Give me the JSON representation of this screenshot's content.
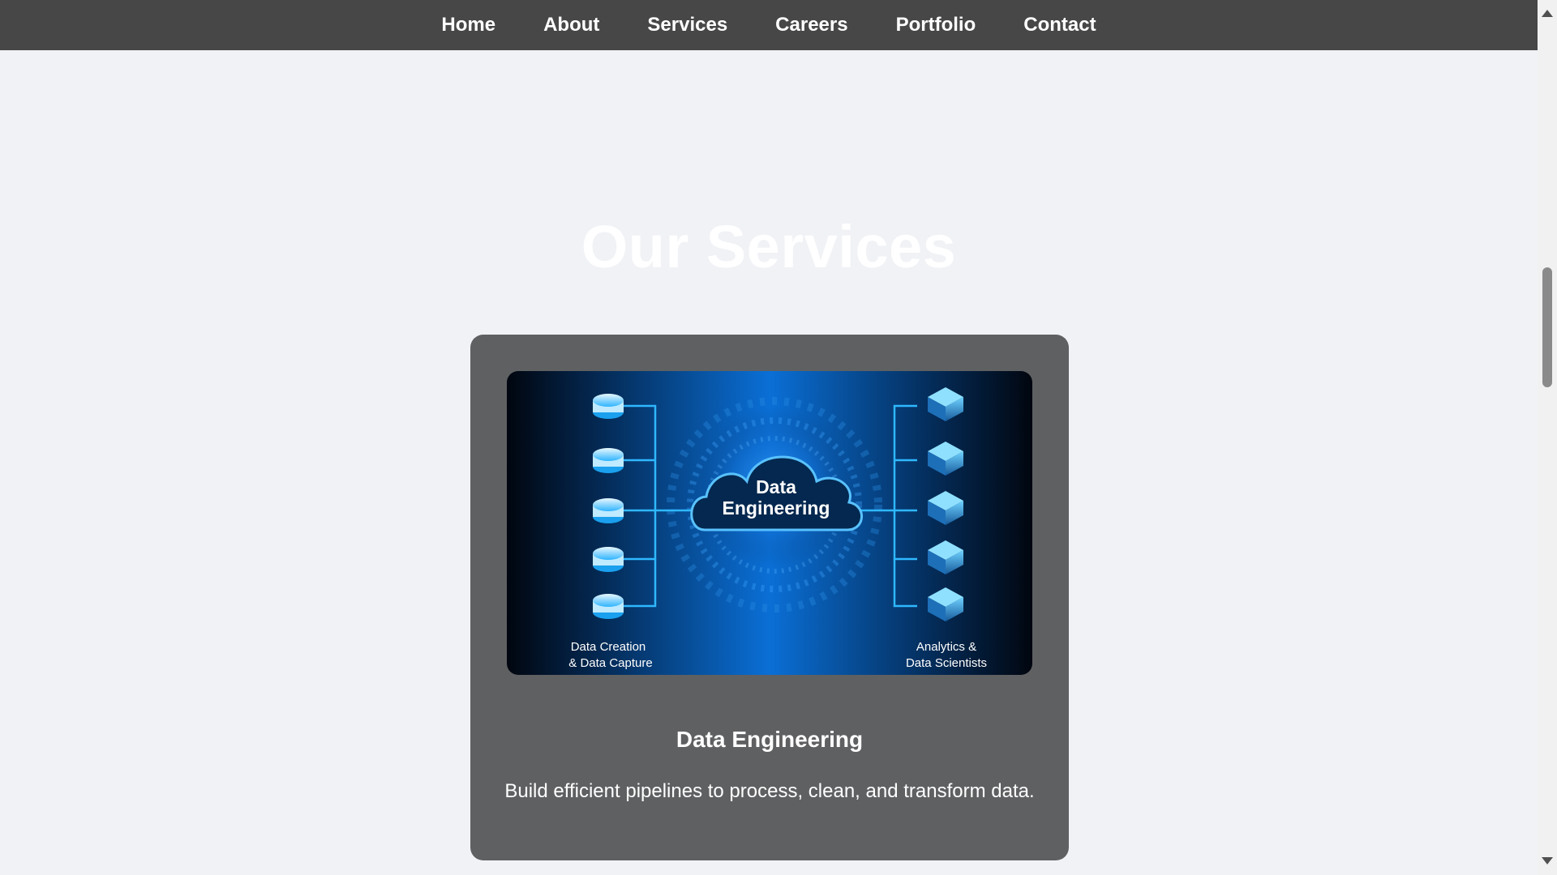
{
  "nav": {
    "items": [
      {
        "label": "Home"
      },
      {
        "label": "About"
      },
      {
        "label": "Services"
      },
      {
        "label": "Careers"
      },
      {
        "label": "Portfolio"
      },
      {
        "label": "Contact"
      }
    ]
  },
  "main": {
    "section_title": "Our Services",
    "card": {
      "title": "Data Engineering",
      "description": "Build efficient pipelines to process, clean, and transform data.",
      "image": {
        "center_label_line1": "Data",
        "center_label_line2": "Engineering",
        "left_caption_line1": "Data Creation",
        "left_caption_line2": "& Data Capture",
        "right_caption_line1": "Analytics &",
        "right_caption_line2": "Data Scientists"
      }
    }
  },
  "colors": {
    "nav_bg": "#474747",
    "page_bg": "#f0f2f5",
    "card_bg": "#5f6062",
    "accent_blue": "#1a8cff"
  }
}
